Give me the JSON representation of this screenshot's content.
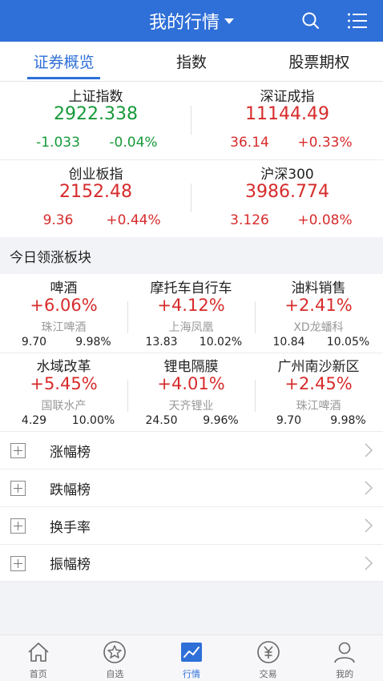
{
  "header": {
    "title": "我的行情"
  },
  "tabs": [
    {
      "label": "证券概览",
      "active": true
    },
    {
      "label": "指数",
      "active": false
    },
    {
      "label": "股票期权",
      "active": false
    }
  ],
  "indices": [
    {
      "name": "上证指数",
      "price": "2922.338",
      "change": "-1.033",
      "pct": "-0.04%",
      "dir": "down"
    },
    {
      "name": "深证成指",
      "price": "11144.49",
      "change": "36.14",
      "pct": "+0.33%",
      "dir": "up"
    },
    {
      "name": "创业板指",
      "price": "2152.48",
      "change": "9.36",
      "pct": "+0.44%",
      "dir": "up"
    },
    {
      "name": "沪深300",
      "price": "3986.774",
      "change": "3.126",
      "pct": "+0.08%",
      "dir": "up"
    }
  ],
  "sectors_title": "今日领涨板块",
  "sectors": [
    {
      "name": "啤酒",
      "pct": "+6.06%",
      "stock": "珠江啤酒",
      "price": "9.70",
      "stock_pct": "9.98%"
    },
    {
      "name": "摩托车自行车",
      "pct": "+4.12%",
      "stock": "上海凤凰",
      "price": "13.83",
      "stock_pct": "10.02%"
    },
    {
      "name": "油料销售",
      "pct": "+2.41%",
      "stock": "XD龙蟠科",
      "price": "10.84",
      "stock_pct": "10.05%"
    },
    {
      "name": "水域改革",
      "pct": "+5.45%",
      "stock": "国联水产",
      "price": "4.29",
      "stock_pct": "10.00%"
    },
    {
      "name": "锂电隔膜",
      "pct": "+4.01%",
      "stock": "天齐锂业",
      "price": "24.50",
      "stock_pct": "9.96%"
    },
    {
      "name": "广州南沙新区",
      "pct": "+2.45%",
      "stock": "珠江啤酒",
      "price": "9.70",
      "stock_pct": "9.98%"
    }
  ],
  "rankings": [
    {
      "label": "涨幅榜"
    },
    {
      "label": "跌幅榜"
    },
    {
      "label": "换手率"
    },
    {
      "label": "振幅榜"
    }
  ],
  "bottom_nav": [
    {
      "label": "首页",
      "icon": "home-icon",
      "active": false
    },
    {
      "label": "自选",
      "icon": "star-icon",
      "active": false
    },
    {
      "label": "行情",
      "icon": "chart-icon",
      "active": true
    },
    {
      "label": "交易",
      "icon": "yuan-icon",
      "active": false
    },
    {
      "label": "我的",
      "icon": "user-icon",
      "active": false
    }
  ],
  "colors": {
    "brand": "#2f6fd8",
    "up": "#d72b2b",
    "down": "#179a3a"
  }
}
